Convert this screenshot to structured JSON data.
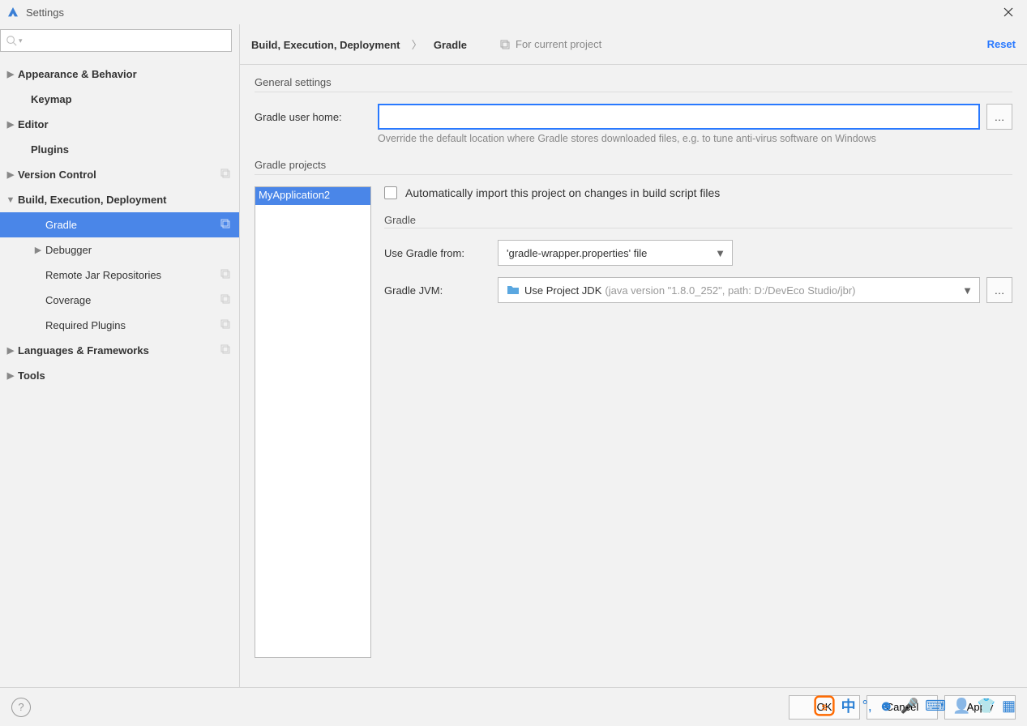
{
  "window": {
    "title": "Settings"
  },
  "sidebar": {
    "items": [
      {
        "label": "Appearance & Behavior",
        "expandable": true,
        "bold": true
      },
      {
        "label": "Keymap",
        "bold": true,
        "indent": 1
      },
      {
        "label": "Editor",
        "expandable": true,
        "bold": true
      },
      {
        "label": "Plugins",
        "bold": true,
        "indent": 1
      },
      {
        "label": "Version Control",
        "expandable": true,
        "bold": true,
        "copy": true
      },
      {
        "label": "Build, Execution, Deployment",
        "expandable": true,
        "bold": true,
        "expanded": true
      },
      {
        "label": "Gradle",
        "indent": 2,
        "selected": true,
        "copy": true
      },
      {
        "label": "Debugger",
        "indent": 2,
        "expandable": true
      },
      {
        "label": "Remote Jar Repositories",
        "indent": 3,
        "copy": true
      },
      {
        "label": "Coverage",
        "indent": 3,
        "copy": true
      },
      {
        "label": "Required Plugins",
        "indent": 3,
        "copy": true
      },
      {
        "label": "Languages & Frameworks",
        "expandable": true,
        "bold": true,
        "copy": true
      },
      {
        "label": "Tools",
        "expandable": true,
        "bold": true
      }
    ]
  },
  "header": {
    "breadcrumb_parent": "Build, Execution, Deployment",
    "breadcrumb_child": "Gradle",
    "for_project": "For current project",
    "reset": "Reset"
  },
  "general": {
    "section": "General settings",
    "user_home_label": "Gradle user home:",
    "user_home_value": "",
    "hint": "Override the default location where Gradle stores downloaded files, e.g. to tune anti-virus software on Windows"
  },
  "projects": {
    "section": "Gradle projects",
    "list": [
      "MyApplication2"
    ],
    "auto_import": "Automatically import this project on changes in build script files",
    "gradle_section": "Gradle",
    "use_from_label": "Use Gradle from:",
    "use_from_value": "'gradle-wrapper.properties' file",
    "jvm_label": "Gradle JVM:",
    "jvm_value": "Use Project JDK",
    "jvm_detail": "(java version \"1.8.0_252\", path: D:/DevEco Studio/jbr)"
  },
  "footer": {
    "ok": "OK",
    "cancel": "Cancel",
    "apply": "Apply"
  },
  "ime": {
    "lang": "中"
  }
}
